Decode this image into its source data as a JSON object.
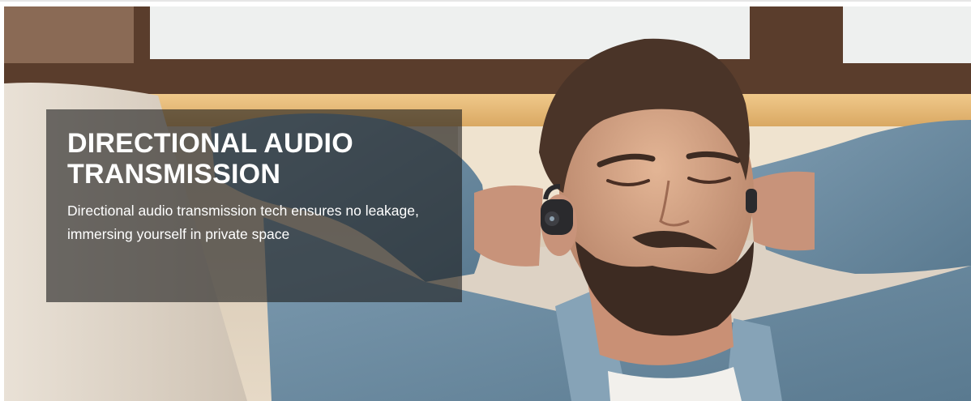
{
  "hero": {
    "headline_line1": "DIRECTIONAL AUDIO",
    "headline_line2": "TRANSMISSION",
    "description": "Directional audio transmission tech ensures no leakage, immersing yourself in private space",
    "image_subject": "man relaxing on sofa wearing open-ear earbud"
  },
  "colors": {
    "overlay": "#1e1e1e",
    "headline": "#ffffff",
    "shirt": "#6f8ea3",
    "window_light": "#f1f1ee",
    "wood_frame": "#5a3d2c"
  }
}
